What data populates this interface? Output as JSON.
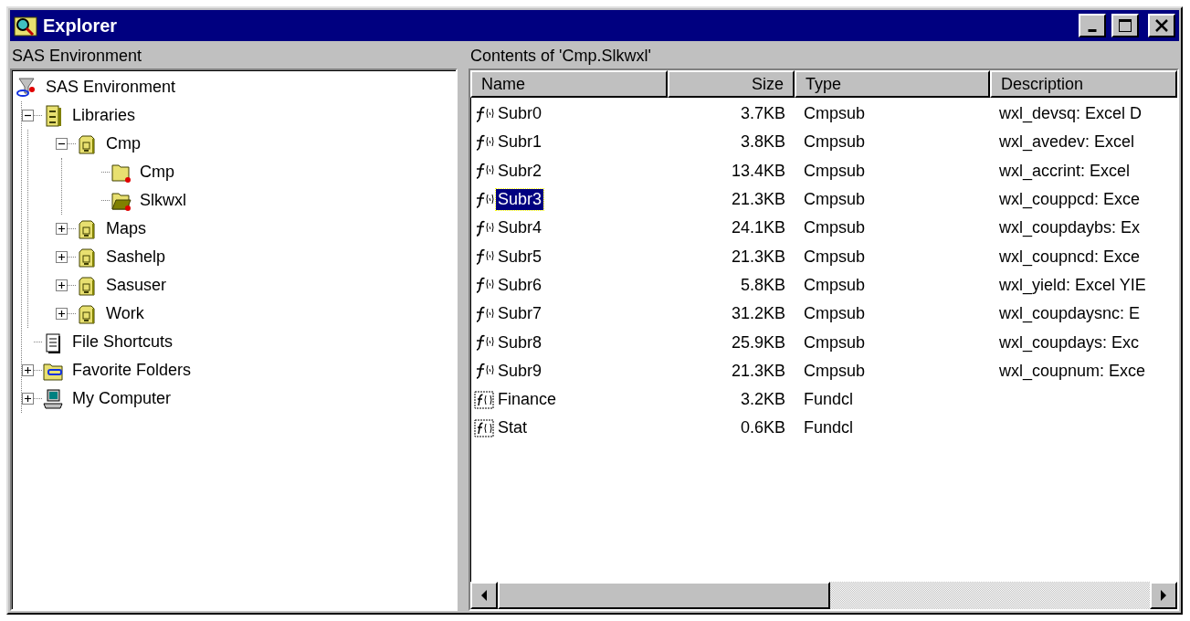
{
  "window": {
    "title": "Explorer"
  },
  "tree_pane": {
    "title": "SAS Environment"
  },
  "tree": [
    {
      "label": "SAS Environment",
      "kind": "environment",
      "children": [
        {
          "label": "Libraries",
          "kind": "libraries",
          "expanded": true,
          "children": [
            {
              "label": "Cmp",
              "kind": "library",
              "expanded": true,
              "children": [
                {
                  "label": "Cmp",
                  "kind": "catalog"
                },
                {
                  "label": "Slkwxl",
                  "kind": "catalog-open"
                }
              ]
            },
            {
              "label": "Maps",
              "kind": "library",
              "expanded": false
            },
            {
              "label": "Sashelp",
              "kind": "library",
              "expanded": false
            },
            {
              "label": "Sasuser",
              "kind": "library",
              "expanded": false
            },
            {
              "label": "Work",
              "kind": "library",
              "expanded": false
            }
          ]
        },
        {
          "label": "File Shortcuts",
          "kind": "shortcuts"
        },
        {
          "label": "Favorite Folders",
          "kind": "favorites",
          "expanded": false
        },
        {
          "label": "My Computer",
          "kind": "computer",
          "expanded": false
        }
      ]
    }
  ],
  "contents_pane": {
    "title": "Contents of 'Cmp.Slkwxl'"
  },
  "table": {
    "columns": [
      "Name",
      "Size",
      "Type",
      "Description"
    ],
    "rows": [
      {
        "name": "Subr0",
        "size": "3.7KB",
        "type": "Cmpsub",
        "description": "wxl_devsq: Excel D",
        "kind": "subr",
        "selected": false
      },
      {
        "name": "Subr1",
        "size": "3.8KB",
        "type": "Cmpsub",
        "description": "wxl_avedev: Excel",
        "kind": "subr",
        "selected": false
      },
      {
        "name": "Subr2",
        "size": "13.4KB",
        "type": "Cmpsub",
        "description": "wxl_accrint: Excel",
        "kind": "subr",
        "selected": false
      },
      {
        "name": "Subr3",
        "size": "21.3KB",
        "type": "Cmpsub",
        "description": "wxl_couppcd: Exce",
        "kind": "subr",
        "selected": true
      },
      {
        "name": "Subr4",
        "size": "24.1KB",
        "type": "Cmpsub",
        "description": "wxl_coupdaybs: Ex",
        "kind": "subr",
        "selected": false
      },
      {
        "name": "Subr5",
        "size": "21.3KB",
        "type": "Cmpsub",
        "description": "wxl_coupncd: Exce",
        "kind": "subr",
        "selected": false
      },
      {
        "name": "Subr6",
        "size": "5.8KB",
        "type": "Cmpsub",
        "description": "wxl_yield: Excel YIE",
        "kind": "subr",
        "selected": false
      },
      {
        "name": "Subr7",
        "size": "31.2KB",
        "type": "Cmpsub",
        "description": "wxl_coupdaysnc: E",
        "kind": "subr",
        "selected": false
      },
      {
        "name": "Subr8",
        "size": "25.9KB",
        "type": "Cmpsub",
        "description": "wxl_coupdays: Exc",
        "kind": "subr",
        "selected": false
      },
      {
        "name": "Subr9",
        "size": "21.3KB",
        "type": "Cmpsub",
        "description": "wxl_coupnum: Exce",
        "kind": "subr",
        "selected": false
      },
      {
        "name": "Finance",
        "size": "3.2KB",
        "type": "Fundcl",
        "kind": "fundcl",
        "selected": false
      },
      {
        "name": "Stat",
        "size": "0.6KB",
        "type": "Fundcl",
        "kind": "fundcl",
        "selected": false
      }
    ]
  }
}
